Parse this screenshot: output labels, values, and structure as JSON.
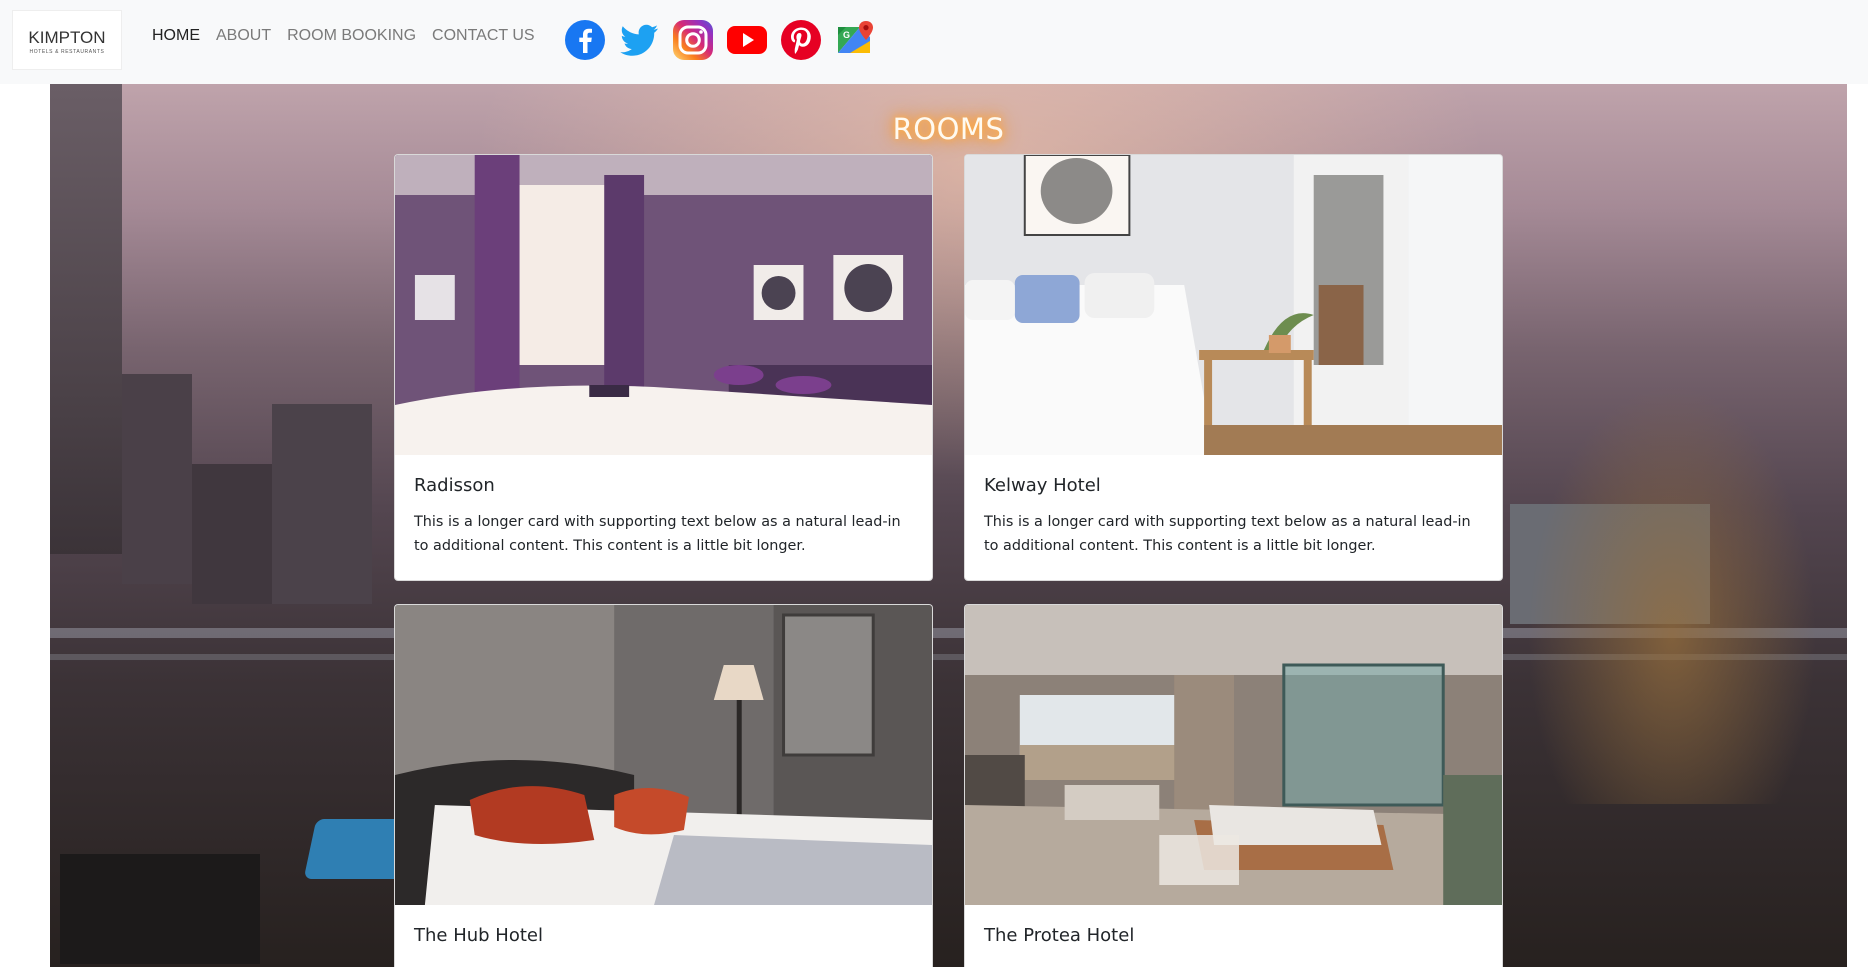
{
  "brand": {
    "name": "KIMPTON",
    "tagline": "HOTELS & RESTAURANTS"
  },
  "nav": {
    "links": [
      {
        "label": "HOME",
        "active": true
      },
      {
        "label": "ABOUT",
        "active": false
      },
      {
        "label": "ROOM BOOKING",
        "active": false
      },
      {
        "label": "CONTACT US",
        "active": false
      }
    ]
  },
  "socials": [
    {
      "icon": "facebook-icon",
      "color": "#1877f2"
    },
    {
      "icon": "twitter-icon",
      "color": "#1da1f2"
    },
    {
      "icon": "instagram-icon",
      "color": "#c13584"
    },
    {
      "icon": "youtube-icon",
      "color": "#ff0000"
    },
    {
      "icon": "pinterest-icon",
      "color": "#e60023"
    },
    {
      "icon": "google-maps-icon",
      "color": "#34a853"
    }
  ],
  "section": {
    "title": "ROOMS"
  },
  "cards": [
    {
      "title": "Radisson",
      "text": "This is a longer card with supporting text below as a natural lead-in to additional content. This content is a little bit longer."
    },
    {
      "title": "Kelway Hotel",
      "text": "This is a longer card with supporting text below as a natural lead-in to additional content. This content is a little bit longer."
    },
    {
      "title": "The Hub Hotel",
      "text": ""
    },
    {
      "title": "The Protea Hotel",
      "text": ""
    }
  ],
  "colors": {
    "navbar_bg": "#f8f9fa",
    "title_glow": "#ff9a2a",
    "nav_active": "#222222",
    "nav_inactive": "#7a7a7a"
  }
}
